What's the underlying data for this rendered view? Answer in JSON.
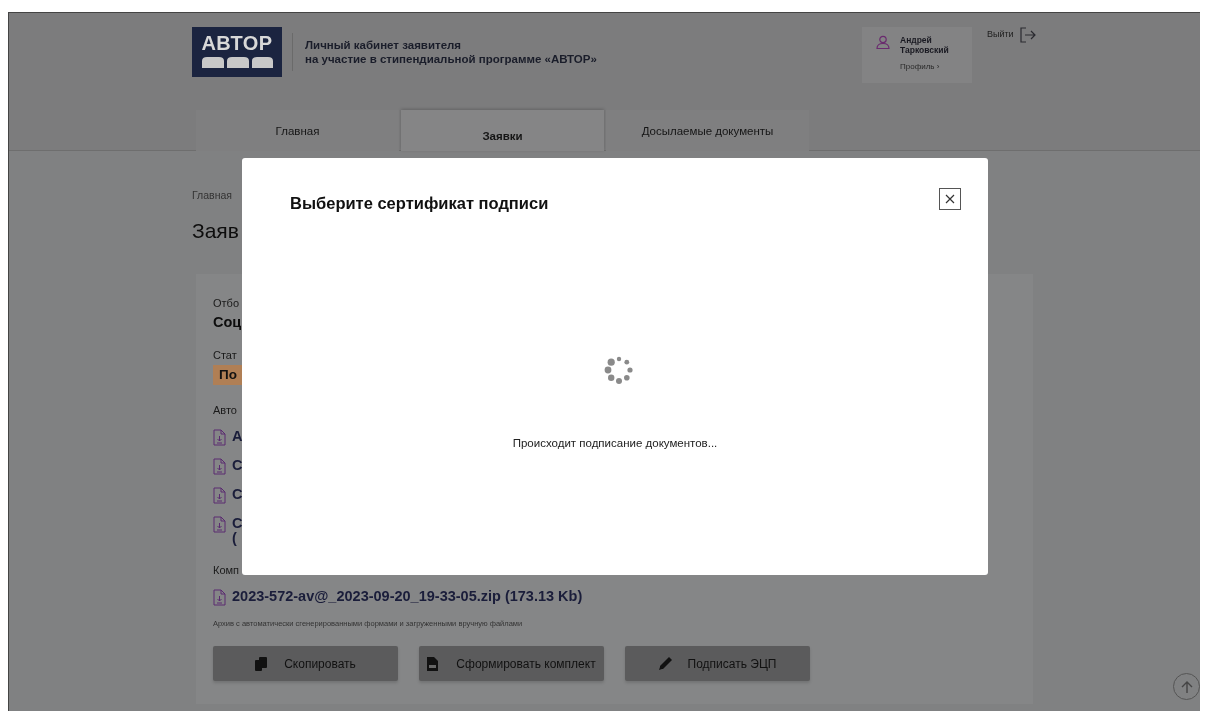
{
  "header": {
    "logo_text": "АВТОР",
    "title_lines": [
      "Личный кабинет заявителя",
      "на участие в стипендиальной программе «АВТОР»"
    ],
    "user": {
      "name_lines": [
        "Андрей",
        "Тарковский"
      ],
      "profile_link": "Профиль ›"
    },
    "logout": "Выйти"
  },
  "tabs": [
    {
      "label": "Главная",
      "selected": false
    },
    {
      "label": "Заявки",
      "selected": true
    },
    {
      "label": "Досылаемые документы",
      "selected": false
    }
  ],
  "breadcrumb": "Главная",
  "heading": "Заяв",
  "card": {
    "items": [
      {
        "kind": "label",
        "text": "Отбо"
      },
      {
        "kind": "value",
        "text": "Соц"
      },
      {
        "kind": "label",
        "text": "Стат"
      },
      {
        "kind": "badge",
        "text": "По"
      },
      {
        "kind": "label",
        "text": "Авто"
      },
      {
        "kind": "file",
        "lines": [
          "А"
        ]
      },
      {
        "kind": "file",
        "lines": [
          "С"
        ]
      },
      {
        "kind": "file",
        "lines": [
          "С"
        ]
      },
      {
        "kind": "file",
        "lines": [
          "С",
          "("
        ]
      },
      {
        "kind": "label",
        "text": "Комп"
      },
      {
        "kind": "file",
        "lines": [
          "2023-572-av@_2023-09-20_19-33-05.zip (173.13 Kb)"
        ]
      },
      {
        "kind": "caption",
        "text": "Архив с автоматически сгенерированными формами и загруженными вручную файлами"
      }
    ],
    "buttons": [
      {
        "label": "Скопировать",
        "kind": "copy"
      },
      {
        "label": "Сформировать комплект",
        "kind": "document"
      },
      {
        "label": "Подписать ЭЦП",
        "kind": "pencil"
      }
    ]
  },
  "modal": {
    "title": "Выберите сертификат подписи",
    "message": "Происходит подписание документов..."
  }
}
